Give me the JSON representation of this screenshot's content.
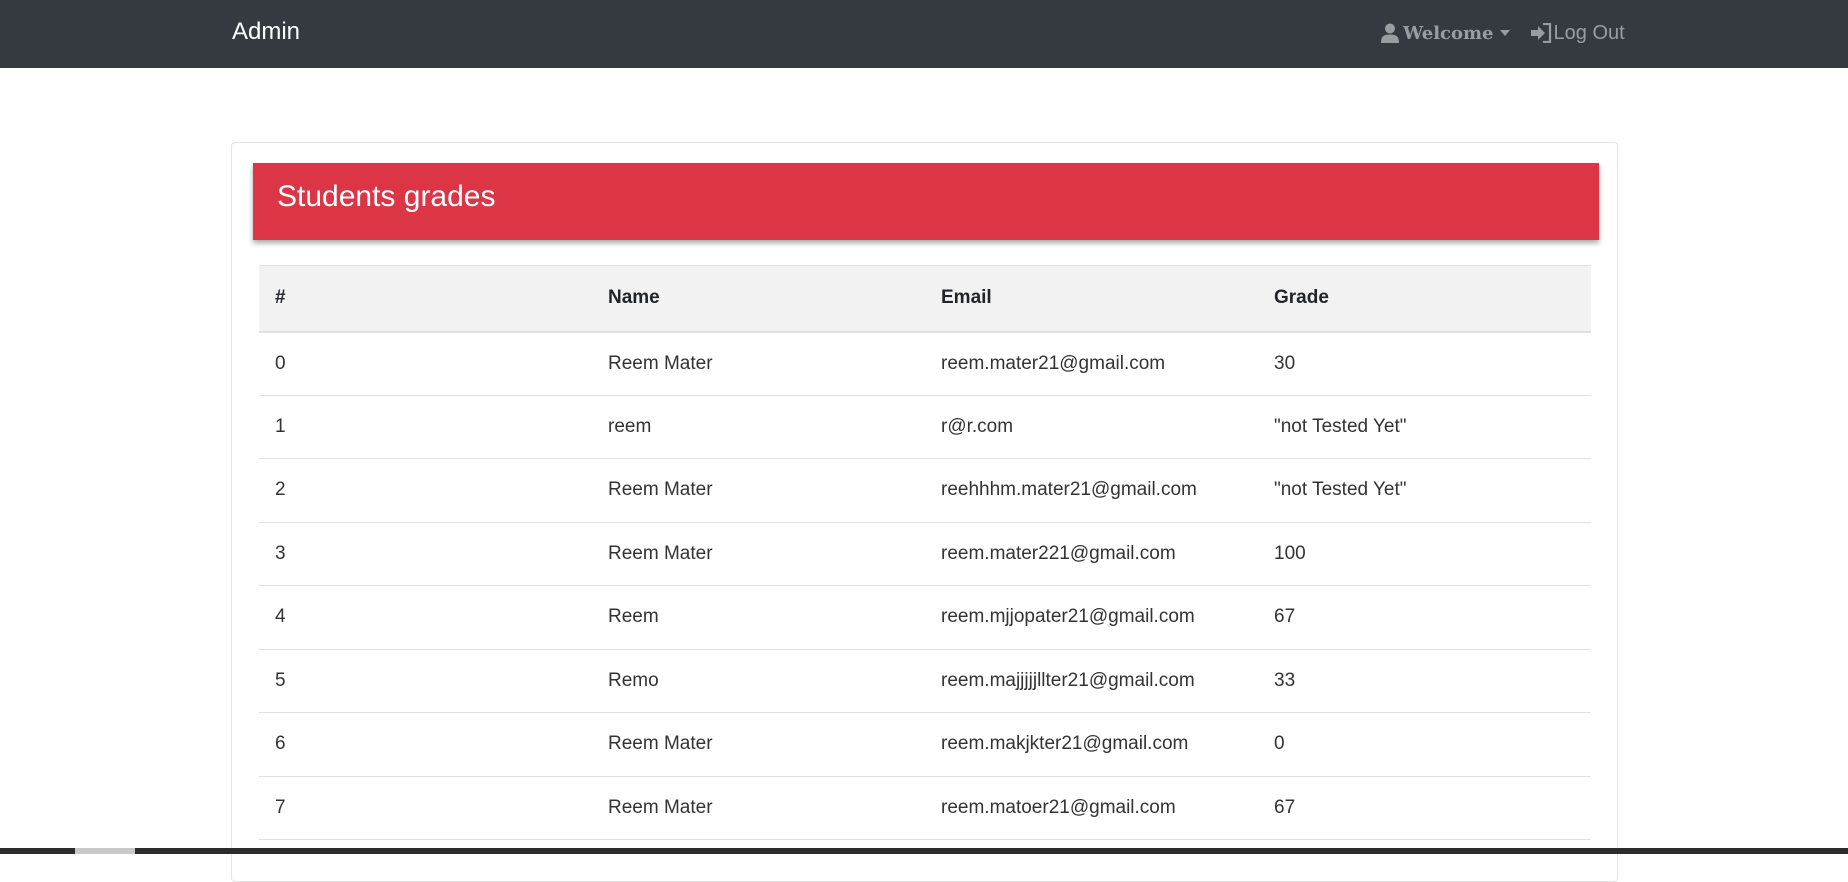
{
  "navbar": {
    "brand": "Admin",
    "welcome_label": "Welcome",
    "logout_label": "Log Out"
  },
  "card": {
    "title": "Students grades"
  },
  "table": {
    "headers": [
      "#",
      "Name",
      "Email",
      "Grade"
    ],
    "rows": [
      [
        "0",
        "Reem Mater",
        "reem.mater21@gmail.com",
        "30"
      ],
      [
        "1",
        "reem",
        "r@r.com",
        "\"not Tested Yet\""
      ],
      [
        "2",
        "Reem Mater",
        "reehhhm.mater21@gmail.com",
        "\"not Tested Yet\""
      ],
      [
        "3",
        "Reem Mater",
        "reem.mater221@gmail.com",
        "100"
      ],
      [
        "4",
        "Reem",
        "reem.mjjopater21@gmail.com",
        "67"
      ],
      [
        "5",
        "Remo",
        "reem.majjjjjllter21@gmail.com",
        "33"
      ],
      [
        "6",
        "Reem Mater",
        "reem.makjkter21@gmail.com",
        "0"
      ],
      [
        "7",
        "Reem Mater",
        "reem.matoer21@gmail.com",
        "67"
      ]
    ]
  },
  "colors": {
    "navbar_bg": "#343a40",
    "header_bg": "#dc3545",
    "table_header_bg": "#f2f2f2"
  }
}
